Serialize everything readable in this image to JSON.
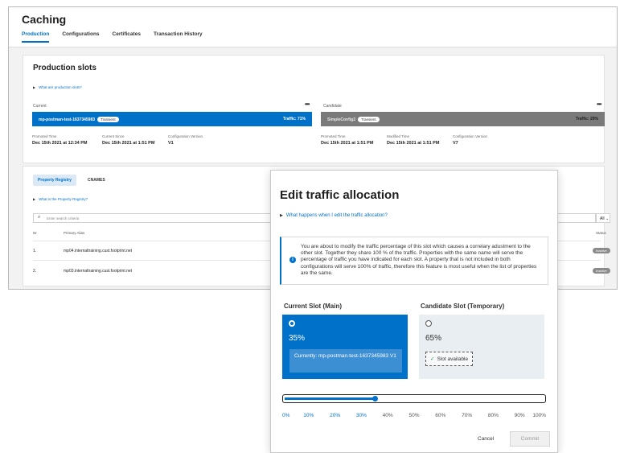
{
  "app": {
    "title": "Caching",
    "tabs": [
      "Production",
      "Configurations",
      "Certificates",
      "Transaction History"
    ]
  },
  "production_slots": {
    "title": "Production slots",
    "help_link": "What are production slots?",
    "current": {
      "label": "Current",
      "name": "mp-postman-test-1637345983",
      "badge": "Transient",
      "traffic": "Traffic: 71%",
      "promoted_label": "Promoted Time",
      "promoted_value": "Dec 15th 2021 at 12:34 PM",
      "since_label": "Current Since",
      "since_value": "Dec 15th 2021 at 1:51 PM",
      "version_label": "Configuration Version",
      "version_value": "V1"
    },
    "candidate": {
      "label": "Candidate",
      "name": "SimpleConfig2",
      "badge": "Transient",
      "traffic": "Traffic: 29%",
      "promoted_label": "Promoted Time",
      "promoted_value": "Dec 15th 2021 at 1:51 PM",
      "modified_label": "Modified Time",
      "modified_value": "Dec 15th 2021 at 1:51 PM",
      "version_label": "Configuration Version",
      "version_value": "V7"
    }
  },
  "registry": {
    "tabs": [
      "Property Registry",
      "CNAMES"
    ],
    "help_link": "What is the Property Registry?",
    "search_placeholder": "Enter search criteria",
    "filter_value": "All",
    "columns": [
      "Nr",
      "Primary Alias",
      "Status"
    ],
    "rows": [
      {
        "nr": "1.",
        "alias": "mp04.internaltraining.cust.footprint.net",
        "status": "Inactive"
      },
      {
        "nr": "2.",
        "alias": "mp03.internaltraining.cust.footprint.net",
        "status": "Inactive"
      }
    ]
  },
  "modal": {
    "title": "Edit traffic allocation",
    "help_link": "What happens when I edit the traffic allocation?",
    "info_text": "You are about to modify the traffic percentage of this slot which causes a correlary adustment to the other slot. Together they share 100 % of the traffic. Properties with the same name will serve the percentage of traffic you have indicated for each slot. A property that is not included in both configurations will serve 100% of traffic, therefore this feature is most useful when the list of properties are the same.",
    "main_slot": {
      "heading": "Current Slot (Main)",
      "percent": "35%",
      "currently": "Currently: mp-postman-test-1637345983 V1"
    },
    "candidate_slot": {
      "heading": "Candidate Slot (Temporary)",
      "percent": "65%",
      "status": "Slot available"
    },
    "slider": {
      "value": 35,
      "ticks": [
        "0%",
        "10%",
        "20%",
        "30%",
        "40%",
        "50%",
        "60%",
        "70%",
        "80%",
        "90%",
        "100%"
      ]
    },
    "cancel_label": "Cancel",
    "commit_label": "Commit"
  },
  "colors": {
    "accent": "#0071c9",
    "candidate_bar": "#7a7a7a",
    "success": "#1e9e4a"
  }
}
